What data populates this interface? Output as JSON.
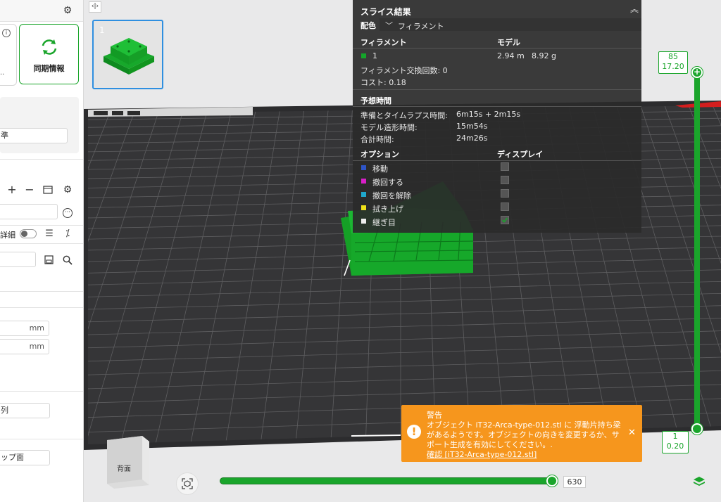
{
  "sidebar": {
    "sync_label": "同期情報",
    "preset_value": "準",
    "detail_label": "詳細",
    "field1_unit": "mm",
    "field2_unit": "mm",
    "field3_value": "列",
    "field4_value": "ップ面"
  },
  "thumbnail": {
    "index": "1"
  },
  "slice_panel": {
    "title": "スライス結果",
    "color_scheme_label": "配色",
    "color_scheme_value": "フィラメント",
    "col_filament": "フィラメント",
    "col_model": "モデル",
    "filament_id": "1",
    "filament_color": "#14a52a",
    "model_length": "2.94 m",
    "model_weight": "8.92 g",
    "change_count": "フィラメント交換回数:  0",
    "cost": "コスト:  0.18",
    "time_header": "予想時間",
    "time_rows": [
      {
        "label": "準備とタイムラプス時間:",
        "value": "6m15s + 2m15s"
      },
      {
        "label": "モデル造形時間:",
        "value": "15m54s"
      },
      {
        "label": "合計時間:",
        "value": "24m26s"
      }
    ],
    "col_options": "オプション",
    "col_display": "ディスプレイ",
    "options": [
      {
        "label": "移動",
        "color": "#2e55c8",
        "checked": false
      },
      {
        "label": "撤回する",
        "color": "#d81fc8",
        "checked": false
      },
      {
        "label": "撤回を解除",
        "color": "#1fa7cc",
        "checked": false
      },
      {
        "label": "拭き上げ",
        "color": "#f0e01a",
        "checked": false
      },
      {
        "label": "継ぎ目",
        "color": "#eeeeee",
        "checked": true
      }
    ]
  },
  "layer_slider": {
    "top_layer": "85",
    "top_height": "17.20",
    "bottom_layer": "1",
    "bottom_height": "0.20",
    "color": "#1aa52b"
  },
  "move_slider": {
    "value": "630"
  },
  "warning": {
    "title": "警告",
    "line1": "オブジェクト iT32-Arca-type-012.stl に 浮動片持ち梁",
    "line2": "があるようです。オブジェクトの向きを変更するか、サ",
    "line3": "ポート生成を有効にしてください。.",
    "link": "確認 [iT32-Arca-type-012.stl]"
  },
  "view_cube": {
    "face": "背面"
  }
}
